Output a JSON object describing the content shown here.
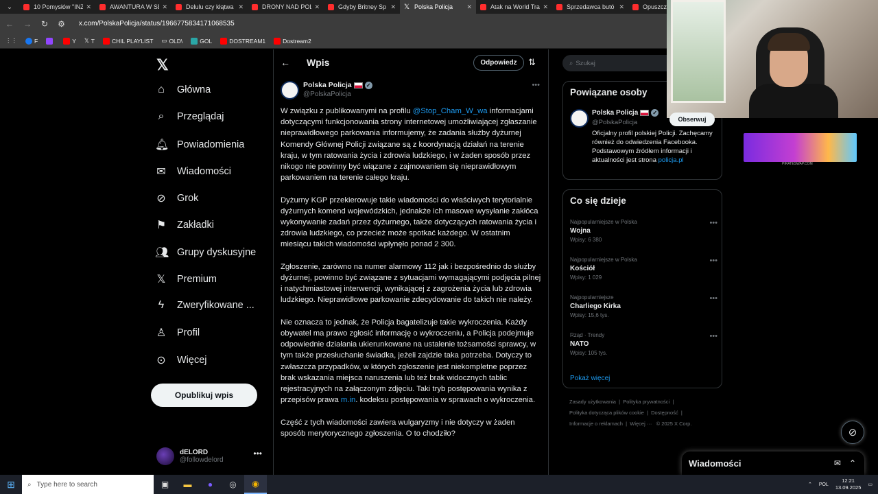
{
  "browser": {
    "tabs": [
      {
        "label": "10 Pomysłów \"INZ",
        "fav": "yt"
      },
      {
        "label": "AWANTURA W SE",
        "fav": "yt"
      },
      {
        "label": "Delulu czy kłątwa",
        "fav": "yt"
      },
      {
        "label": "DRONY NAD POL",
        "fav": "yt"
      },
      {
        "label": "Gdyby Britney Sp",
        "fav": "yt"
      },
      {
        "label": "Polska Policja",
        "fav": "x",
        "active": true
      },
      {
        "label": "Atak na World Tra",
        "fav": "yt"
      },
      {
        "label": "Sprzedawca butó",
        "fav": "yt"
      },
      {
        "label": "Opuszczo",
        "fav": "yt"
      }
    ],
    "url": "x.com/PolskaPolicja/status/1966775834171068535",
    "bookmarks": [
      "F",
      "",
      "Y",
      "T",
      "CHIL PLAYLIST",
      "OLD\\",
      "GOL",
      "DOSTREAM1",
      "Dostream2"
    ]
  },
  "nav": {
    "items": [
      "Główna",
      "Przeglądaj",
      "Powiadomienia",
      "Wiadomości",
      "Grok",
      "Zakładki",
      "Grupy dyskusyjne",
      "Premium",
      "Zweryfikowane ...",
      "Profil",
      "Więcej"
    ],
    "post_button": "Opublikuj wpis",
    "account_name": "dELORD",
    "account_handle": "@followdelord"
  },
  "header": {
    "title": "Wpis",
    "reply_button": "Odpowiedz"
  },
  "post": {
    "author": "Polska Policja",
    "handle": "@PolskaPolicja",
    "p1_a": "W związku z publikowanymi na profilu ",
    "p1_link": "@Stop_Cham_W_wa",
    "p1_b": " informacjami dotyczącymi funkcjonowania strony internetowej umożliwiającej zgłaszanie nieprawidłowego parkowania informujemy, że zadania służby dyżurnej Komendy Głównej Policji związane są z koordynacją działań na terenie kraju, w tym ratowania życia i zdrowia ludzkiego, i w żaden sposób przez nikogo nie powinny być wiązane z zajmowaniem się nieprawidłowym parkowaniem na terenie całego kraju.",
    "p2": "Dyżurny KGP przekierowuje takie wiadomości do właściwych terytorialnie dyżurnych komend wojewódzkich, jednakże ich masowe wysyłanie zakłóca wykonywanie zadań przez dyżurnego, także dotyczących ratowania życia i zdrowia ludzkiego, co przecież może spotkać każdego. W ostatnim miesiącu takich wiadomości wpłynęło ponad 2 300.",
    "p3": "Zgłoszenie, zarówno na numer alarmowy 112 jak i bezpośrednio do służby dyżurnej, powinno być związane z sytuacjami wymagającymi podjęcia pilnej i natychmiastowej interwencji, wynikającej z zagrożenia życia lub zdrowia ludzkiego. Nieprawidłowe parkowanie zdecydowanie do takich nie należy.",
    "p4_a": "Nie oznacza to jednak, że Policja bagatelizuje takie wykroczenia. Każdy obywatel ma prawo zgłosić informację o wykroczeniu, a Policja podejmuje odpowiednie działania ukierunkowane na ustalenie tożsamości sprawcy, w tym także przesłuchanie świadka, jeżeli zajdzie taka potrzeba. Dotyczy to zwłaszcza przypadków, w których zgłoszenie jest niekompletne poprzez brak wskazania miejsca naruszenia lub też brak widocznych tablic rejestracyjnych na załączonym zdjęciu. Taki tryb postępowania wynika z przepisów prawa ",
    "p4_link": "m.in",
    "p4_b": ". kodeksu postępowania w sprawach o wykroczenia.",
    "p5": "Część z tych wiadomości zawiera wulgaryzmy i nie dotyczy w żaden sposób merytorycznego zgłoszenia. O to chodziło?"
  },
  "right": {
    "search_placeholder": "Szukaj",
    "who_title": "Powiązane osoby",
    "who_name": "Polska Policja",
    "who_handle": "@PolskaPolicja",
    "who_bio": "Oficjalny profil polskiej Policji. Zachęcamy również do odwiedzenia Facebooka. Podstawowym źródłem informacji i aktualności jest strona ",
    "who_bio_link": "policja.pl",
    "follow_button": "Obserwuj",
    "trends_title": "Co się dzieje",
    "trends": [
      {
        "context": "Najpopularniejsze w Polska",
        "title": "Wojna",
        "count": "Wpisy: 6 380"
      },
      {
        "context": "Najpopularniejsze w Polska",
        "title": "Kościół",
        "count": "Wpisy: 1 029"
      },
      {
        "context": "Najpopularniejsze",
        "title": "Charliego Kirka",
        "count": "Wpisy: 15,6 tys."
      },
      {
        "context": "Rząd · Trendy",
        "title": "NATO",
        "count": "Wpisy: 105 tys."
      }
    ],
    "show_more": "Pokaż więcej",
    "footer_links": [
      "Zasady użytkowania",
      "Polityka prywatności",
      "Polityka dotycząca plików cookie",
      "Dostępność",
      "Informacje o reklamach",
      "Więcej ···",
      "© 2025 X Corp."
    ]
  },
  "ad_label": "PIRATESWAP.COM",
  "messages_drawer": "Wiadomości",
  "taskbar": {
    "search_placeholder": "Type here to search",
    "lang": "POL",
    "time": "12:21",
    "date": "13.09.2025"
  },
  "colors": {
    "accent": "#1d9bf0",
    "bg": "#000000",
    "text": "#e7e9ea",
    "muted": "#71767b"
  }
}
